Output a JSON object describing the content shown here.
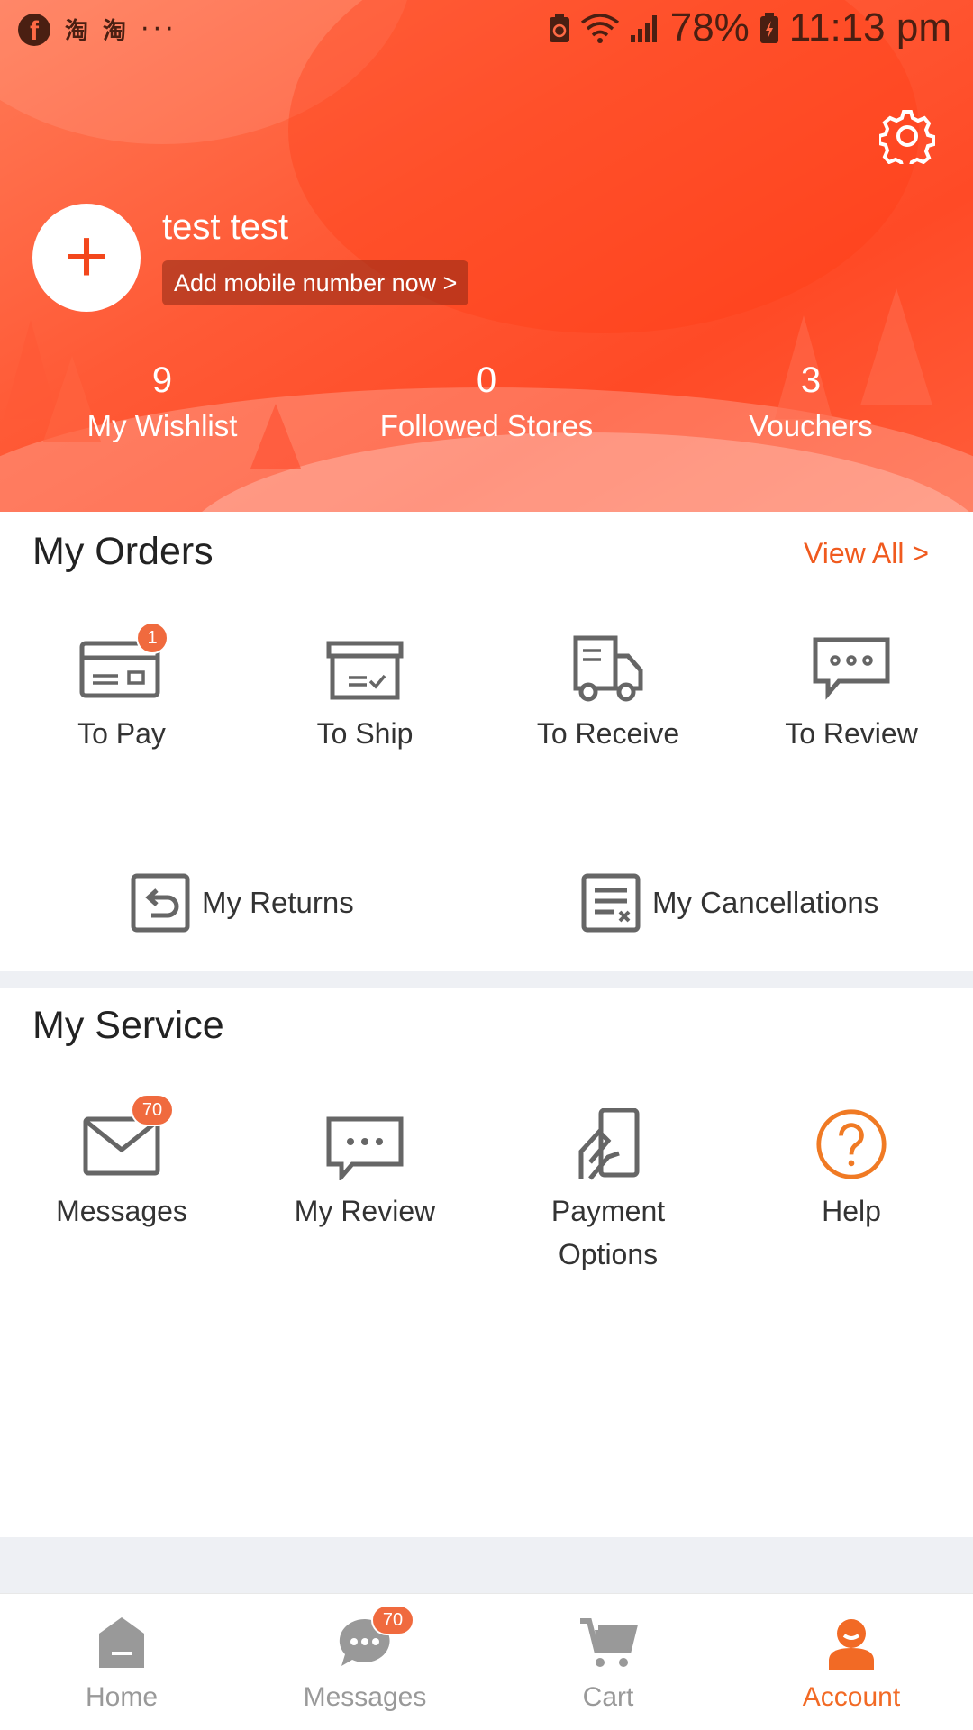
{
  "status_bar": {
    "app_icons": [
      "facebook-icon",
      "taobao-icon",
      "taobao-icon"
    ],
    "app_glyphs": [
      "淘",
      "淘"
    ],
    "more": "···",
    "battery": "78%",
    "time": "11:13 pm"
  },
  "profile": {
    "avatar_symbol": "+",
    "name": "test test",
    "add_mobile": "Add mobile number now >",
    "stats": [
      {
        "value": "9",
        "label": "My Wishlist"
      },
      {
        "value": "0",
        "label": "Followed Stores"
      },
      {
        "value": "3",
        "label": "Vouchers"
      }
    ]
  },
  "orders": {
    "title": "My Orders",
    "view_all": "View All >",
    "items": [
      {
        "label": "To Pay",
        "icon": "wallet-card-icon",
        "badge": "1"
      },
      {
        "label": "To Ship",
        "icon": "box-icon"
      },
      {
        "label": "To Receive",
        "icon": "truck-icon"
      },
      {
        "label": "To Review",
        "icon": "chat-bubble-icon"
      }
    ],
    "returns": "My Returns",
    "cancellations": "My Cancellations"
  },
  "service": {
    "title": "My Service",
    "items": [
      {
        "label": "Messages",
        "icon": "envelope-icon",
        "badge": "70"
      },
      {
        "label": "My Review",
        "icon": "comment-icon"
      },
      {
        "label_line1": "Payment",
        "label_line2": "Options",
        "icon": "payment-card-icon"
      },
      {
        "label": "Help",
        "icon": "help-icon"
      }
    ]
  },
  "bottom_nav": {
    "items": [
      {
        "label": "Home",
        "icon": "home-icon"
      },
      {
        "label": "Messages",
        "icon": "message-icon",
        "badge": "70"
      },
      {
        "label": "Cart",
        "icon": "cart-icon"
      },
      {
        "label": "Account",
        "icon": "account-icon",
        "active": true
      }
    ]
  },
  "colors": {
    "accent": "#f26a25",
    "header_start": "#ff7a57",
    "header_end": "#ff4a26",
    "badge": "#f06a3e",
    "icon_gray": "#666666",
    "divider": "#eef0f4"
  }
}
